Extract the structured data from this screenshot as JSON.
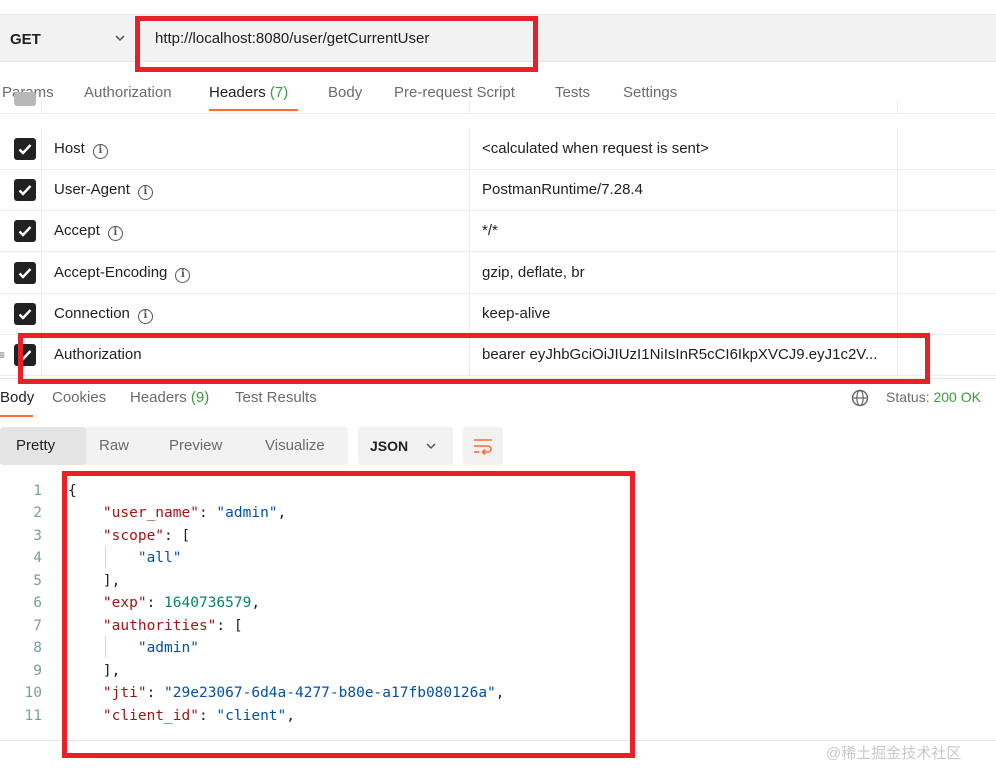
{
  "request": {
    "method": "GET",
    "url": "http://localhost:8080/user/getCurrentUser"
  },
  "request_tabs": [
    {
      "label": "Params"
    },
    {
      "label": "Authorization"
    },
    {
      "label": "Headers",
      "count": "(7)"
    },
    {
      "label": "Body"
    },
    {
      "label": "Pre-request Script"
    },
    {
      "label": "Tests"
    },
    {
      "label": "Settings"
    }
  ],
  "headers": [
    {
      "key": "Host",
      "value": "<calculated when request is sent>",
      "checked": true,
      "info": true
    },
    {
      "key": "User-Agent",
      "value": "PostmanRuntime/7.28.4",
      "checked": true,
      "info": true
    },
    {
      "key": "Accept",
      "value": "*/*",
      "checked": true,
      "info": true
    },
    {
      "key": "Accept-Encoding",
      "value": "gzip, deflate, br",
      "checked": true,
      "info": true
    },
    {
      "key": "Connection",
      "value": "keep-alive",
      "checked": true,
      "info": true
    },
    {
      "key": "Authorization",
      "value": "bearer eyJhbGciOiJIUzI1NiIsInR5cCI6IkpXVCJ9.eyJ1c2V...",
      "checked": true,
      "info": false
    }
  ],
  "response_tabs": [
    {
      "label": "Body"
    },
    {
      "label": "Cookies"
    },
    {
      "label": "Headers",
      "count": "(9)"
    },
    {
      "label": "Test Results"
    }
  ],
  "status": {
    "label": "Status:",
    "value": "200 OK"
  },
  "format_tabs": [
    "Pretty",
    "Raw",
    "Preview",
    "Visualize"
  ],
  "format_select": "JSON",
  "code_lines": [
    {
      "n": "1",
      "text": "{"
    },
    {
      "n": "2",
      "key": "\"user_name\"",
      "val": "\"admin\"",
      "vtype": "s",
      "tail": ","
    },
    {
      "n": "3",
      "key": "\"scope\"",
      "val": "[",
      "vtype": "p"
    },
    {
      "n": "4",
      "val": "\"all\"",
      "vtype": "s",
      "indent": 2
    },
    {
      "n": "5",
      "text": "    ],"
    },
    {
      "n": "6",
      "key": "\"exp\"",
      "val": "1640736579",
      "vtype": "n",
      "tail": ","
    },
    {
      "n": "7",
      "key": "\"authorities\"",
      "val": "[",
      "vtype": "p"
    },
    {
      "n": "8",
      "val": "\"admin\"",
      "vtype": "s",
      "indent": 2
    },
    {
      "n": "9",
      "text": "    ],"
    },
    {
      "n": "10",
      "key": "\"jti\"",
      "val": "\"29e23067-6d4a-4277-b80e-a17fb080126a\"",
      "vtype": "s",
      "tail": ","
    },
    {
      "n": "11",
      "key": "\"client_id\"",
      "val": "\"client\"",
      "vtype": "s",
      "tail": ","
    }
  ],
  "watermark": "@稀土掘金技术社区",
  "colors": {
    "accent": "#ff6c37",
    "annotation": "#e8202a",
    "success": "#3d9a3d"
  }
}
